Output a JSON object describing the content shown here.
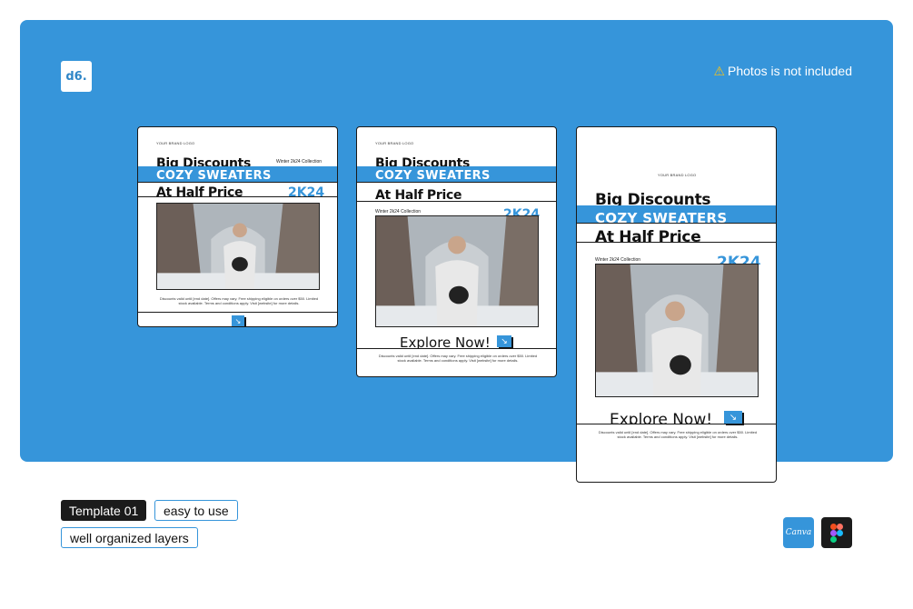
{
  "brand_badge": "d6.",
  "notice": {
    "icon": "warning-icon",
    "text": "Photos is not included"
  },
  "card": {
    "brand_logo": "YOUR BRAND LOGO",
    "collection": "Winter 2k24 Collection",
    "headline1": "Big Discounts",
    "headline2": "COZY SWEATERS",
    "headline3": "At Half Price",
    "year": "2K24",
    "cta": "Explore Now!",
    "fine_print": "Discounts valid until [end date]. Offers may vary. Free shipping eligible on orders over $50. Limited stock available. Terms and conditions apply. Visit [website] for more details."
  },
  "tags": [
    "Template 01",
    "easy to use",
    "well organized layers"
  ],
  "apps": {
    "canva_label": "Canva",
    "figma_icon": "figma-icon"
  },
  "colors": {
    "accent": "#3695da",
    "dark": "#1b1b1b"
  }
}
